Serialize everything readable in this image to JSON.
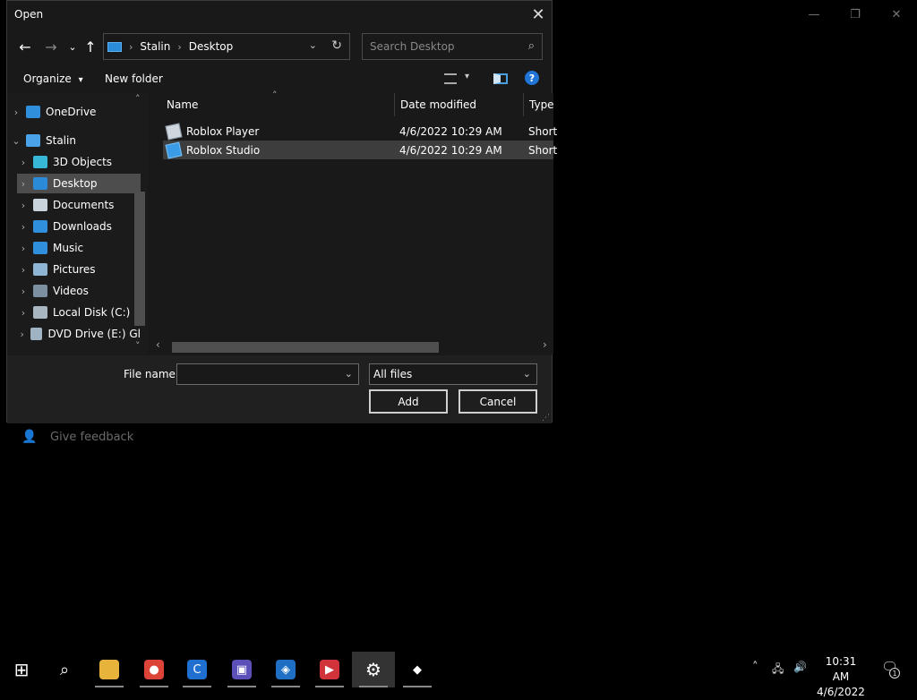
{
  "dialog": {
    "title": "Open",
    "close_glyph": "✕",
    "nav": {
      "back_icon": "arrow-left-icon",
      "forward_icon": "arrow-right-icon",
      "recent_icon": "chevron-down-icon",
      "up_icon": "arrow-up-icon",
      "back_glyph": "←",
      "forward_glyph": "→",
      "recent_glyph": "⌄",
      "up_glyph": "↑"
    },
    "address": {
      "crumbs": [
        "Stalin",
        "Desktop"
      ],
      "separator": "›",
      "dropdown_glyph": "⌄",
      "refresh_glyph": "↻"
    },
    "search": {
      "placeholder": "Search Desktop",
      "icon_glyph": "⌕"
    },
    "toolbar": {
      "organize_label": "Organize",
      "organize_arrow": "▾",
      "new_folder_label": "New folder",
      "view_arrow": "▾",
      "help_glyph": "?"
    },
    "nav_pane": {
      "items": [
        {
          "label": "OneDrive",
          "icon": "cloud-icon",
          "color": "#2f8fdd"
        },
        {
          "label": "Stalin",
          "icon": "computer-icon",
          "color": "#4aa3e8"
        },
        {
          "label": "3D Objects",
          "icon": "cube-icon",
          "color": "#37b6d6"
        },
        {
          "label": "Desktop",
          "icon": "desktop-icon",
          "color": "#2b8ad8"
        },
        {
          "label": "Documents",
          "icon": "document-icon",
          "color": "#c9d3dc"
        },
        {
          "label": "Downloads",
          "icon": "download-icon",
          "color": "#2f8fdd"
        },
        {
          "label": "Music",
          "icon": "music-icon",
          "color": "#2f8fdd"
        },
        {
          "label": "Pictures",
          "icon": "pictures-icon",
          "color": "#8fb5d4"
        },
        {
          "label": "Videos",
          "icon": "videos-icon",
          "color": "#7b8fa0"
        },
        {
          "label": "Local Disk (C:)",
          "icon": "drive-icon",
          "color": "#a8b6c2"
        },
        {
          "label": "DVD Drive (E:) Gl",
          "icon": "dvd-icon",
          "color": "#9fb3c3"
        }
      ],
      "selected": "Desktop",
      "expanded_glyph": "⌄",
      "collapsed_glyph": "›",
      "scroll_up": "˄",
      "scroll_down": "˅"
    },
    "file_list": {
      "columns": [
        "Name",
        "Date modified",
        "Type"
      ],
      "sort_glyph": "˄",
      "rows": [
        {
          "name": "Roblox Player",
          "date": "4/6/2022 10:29 AM",
          "type": "Short"
        },
        {
          "name": "Roblox Studio",
          "date": "4/6/2022 10:29 AM",
          "type": "Short"
        }
      ],
      "selected_row": "Roblox Studio",
      "scroll_left": "‹",
      "scroll_right": "›"
    },
    "bottom": {
      "file_name_label": "File name:",
      "file_name_value": "",
      "filter_value": "All files",
      "dropdown_glyph": "⌄",
      "add_label": "Add",
      "cancel_label": "Cancel"
    }
  },
  "background": {
    "minimize_glyph": "—",
    "restore_glyph": "❐",
    "close_glyph": "✕",
    "feedback_label": "Give feedback"
  },
  "taskbar": {
    "apps": [
      {
        "name": "start-icon",
        "glyph": "⊞",
        "color": "#ffffff",
        "bg": "transparent"
      },
      {
        "name": "search-icon",
        "glyph": "⌕",
        "color": "#ffffff",
        "bg": "transparent"
      },
      {
        "name": "file-explorer-icon",
        "glyph": "▬",
        "color": "#e8b33a",
        "bg": "#e8b33a"
      },
      {
        "name": "chrome-icon",
        "glyph": "●",
        "color": "#ffffff",
        "bg": "#db4437"
      },
      {
        "name": "ccleaner-icon",
        "glyph": "C",
        "color": "#ffffff",
        "bg": "#1e6fd0"
      },
      {
        "name": "app-installer-icon",
        "glyph": "▣",
        "color": "#ffffff",
        "bg": "#5b4fb8"
      },
      {
        "name": "defender-icon",
        "glyph": "◈",
        "color": "#ffffff",
        "bg": "#1f6fc5"
      },
      {
        "name": "video-recorder-icon",
        "glyph": "▶",
        "color": "#ffffff",
        "bg": "#d0343a"
      },
      {
        "name": "settings-icon",
        "glyph": "⚙",
        "color": "#ffffff",
        "bg": "transparent"
      },
      {
        "name": "roblox-icon",
        "glyph": "◆",
        "color": "#ffffff",
        "bg": "transparent"
      }
    ],
    "tray": {
      "chevron_glyph": "˄",
      "network_glyph": "🖧",
      "volume_glyph": "🔊",
      "time": "10:31 AM",
      "date": "4/6/2022",
      "notification_glyph": "🗨",
      "notification_count": "1"
    }
  }
}
